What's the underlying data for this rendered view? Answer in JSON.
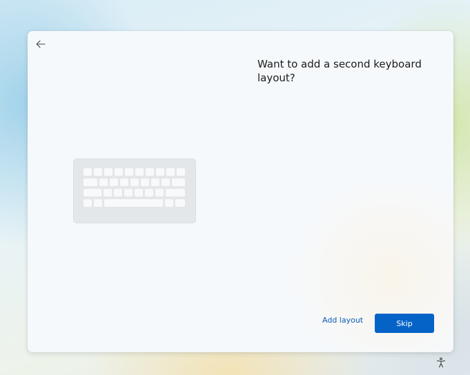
{
  "dialog": {
    "title": "Want to add a second keyboard layout?",
    "back_icon": "arrow-left-icon",
    "illustration_icon": "keyboard-icon"
  },
  "actions": {
    "add_layout_label": "Add layout",
    "skip_label": "Skip"
  },
  "taskbar": {
    "accessibility_icon": "accessibility-icon"
  },
  "colors": {
    "accent": "#0563c8",
    "link": "#0a5bb8",
    "card": "#f6f9fc"
  }
}
